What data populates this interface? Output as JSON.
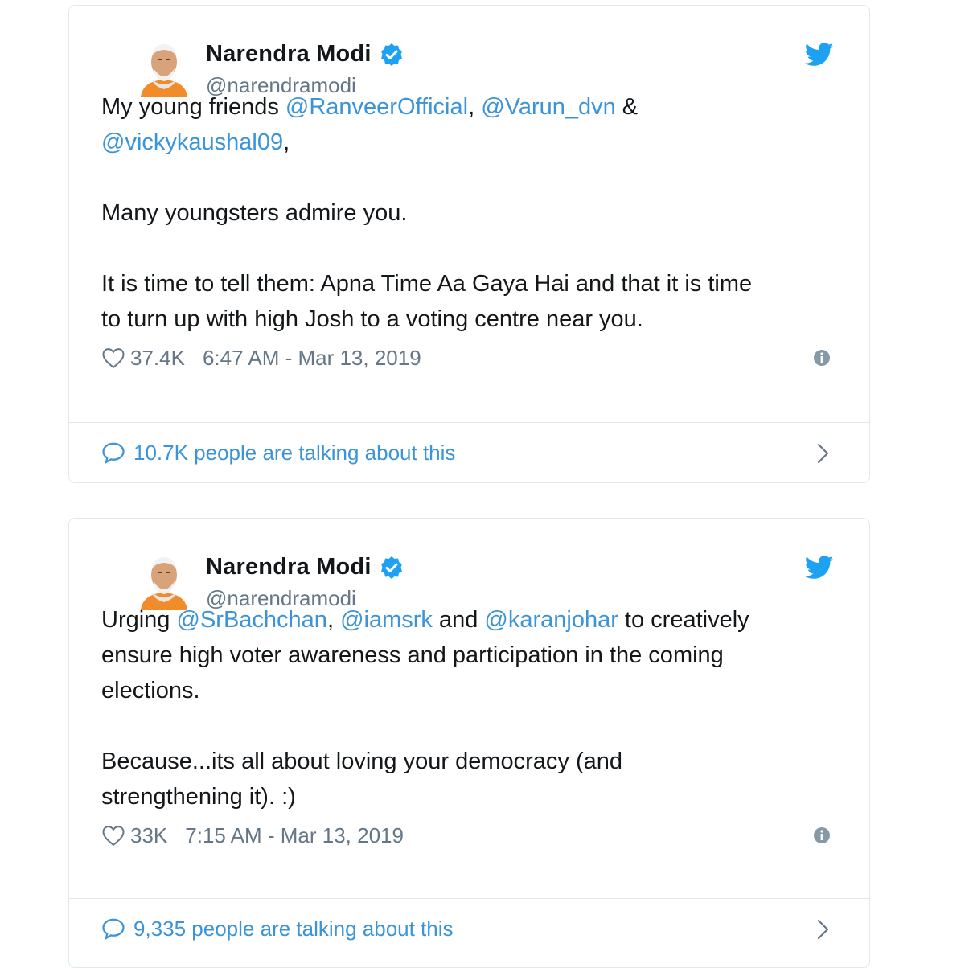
{
  "tweets": [
    {
      "author": {
        "name": "Narendra Modi",
        "handle": "@narendramodi",
        "verified": true
      },
      "paragraphs": [
        [
          {
            "type": "text",
            "value": "My young friends "
          },
          {
            "type": "mention",
            "value": "@RanveerOfficial"
          },
          {
            "type": "text",
            "value": ", "
          },
          {
            "type": "mention",
            "value": "@Varun_dvn"
          },
          {
            "type": "text",
            "value": " & "
          },
          {
            "type": "br"
          },
          {
            "type": "mention",
            "value": "@vickykaushal09"
          },
          {
            "type": "text",
            "value": ","
          }
        ],
        [
          {
            "type": "text",
            "value": "Many youngsters admire you."
          }
        ],
        [
          {
            "type": "text",
            "value": "It is time to tell them: Apna Time Aa Gaya Hai and that it is time "
          },
          {
            "type": "br"
          },
          {
            "type": "text",
            "value": "to turn up with high Josh to a voting centre near you."
          }
        ]
      ],
      "likes": "37.4K",
      "timestamp": "6:47 AM - Mar 13, 2019",
      "talking": "10.7K people are talking about this"
    },
    {
      "author": {
        "name": "Narendra Modi",
        "handle": "@narendramodi",
        "verified": true
      },
      "paragraphs": [
        [
          {
            "type": "text",
            "value": "Urging "
          },
          {
            "type": "mention",
            "value": "@SrBachchan"
          },
          {
            "type": "text",
            "value": ", "
          },
          {
            "type": "mention",
            "value": "@iamsrk"
          },
          {
            "type": "text",
            "value": " and "
          },
          {
            "type": "mention",
            "value": "@karanjohar"
          },
          {
            "type": "text",
            "value": " to creatively "
          },
          {
            "type": "br"
          },
          {
            "type": "text",
            "value": "ensure high voter awareness and participation in the coming "
          },
          {
            "type": "br"
          },
          {
            "type": "text",
            "value": "elections."
          }
        ],
        [
          {
            "type": "text",
            "value": "Because...its all about loving your democracy (and "
          },
          {
            "type": "br"
          },
          {
            "type": "text",
            "value": "strengthening it). :)"
          }
        ]
      ],
      "likes": "33K",
      "timestamp": "7:15 AM - Mar 13, 2019",
      "talking": "9,335 people are talking about this"
    }
  ],
  "icons": {
    "brand": "twitter-bird-icon",
    "verified": "verified-badge-icon",
    "like": "heart-icon",
    "info": "info-icon",
    "reply": "speech-bubble-icon",
    "open": "chevron-right-icon"
  },
  "colors": {
    "link": "#3b94d9",
    "twitter_blue": "#1da1f2",
    "secondary_text": "#657786",
    "border": "#e1e8ed",
    "avatar_saffron": "#f08c2a"
  }
}
